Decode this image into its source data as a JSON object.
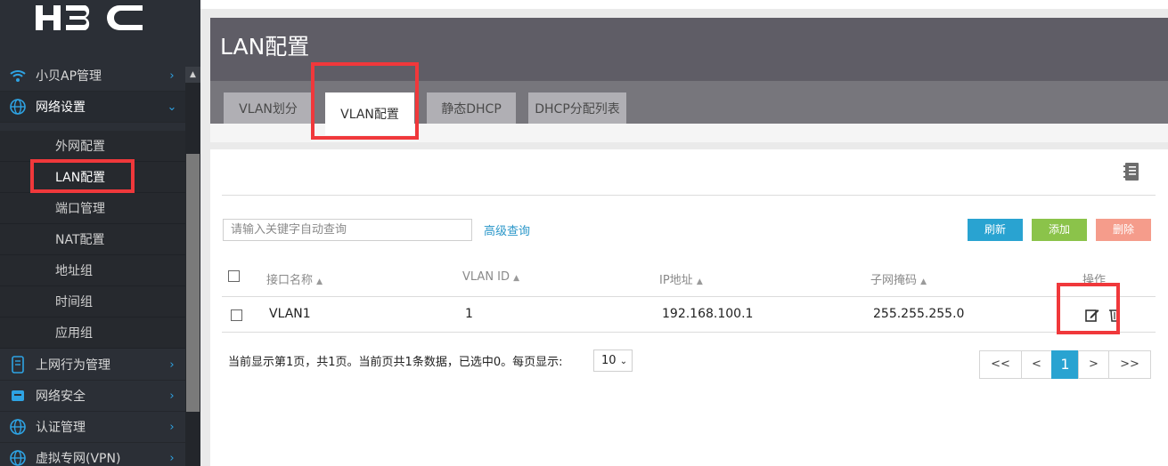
{
  "logo": {
    "text": "H3C"
  },
  "sidebar": {
    "items": [
      {
        "label": "小贝AP管理",
        "icon": "wifi-icon"
      },
      {
        "label": "网络设置",
        "icon": "globe-icon"
      },
      {
        "label": "上网行为管理",
        "icon": "device-icon"
      },
      {
        "label": "网络安全",
        "icon": "shield-icon"
      },
      {
        "label": "认证管理",
        "icon": "globe-icon"
      },
      {
        "label": "虚拟专网(VPN)",
        "icon": "globe-icon"
      }
    ],
    "subitems": [
      "外网配置",
      "LAN配置",
      "端口管理",
      "NAT配置",
      "地址组",
      "时间组",
      "应用组"
    ],
    "selected_subitem": "LAN配置"
  },
  "page": {
    "title": "LAN配置",
    "tabs": [
      "VLAN划分",
      "VLAN配置",
      "静态DHCP",
      "DHCP分配列表"
    ],
    "active_tab": "VLAN配置"
  },
  "toolbar": {
    "search_placeholder": "请输入关键字自动查询",
    "advanced_label": "高级查询",
    "refresh_label": "刷新",
    "add_label": "添加",
    "delete_label": "删除"
  },
  "table": {
    "columns": [
      "接口名称",
      "VLAN ID",
      "IP地址",
      "子网掩码",
      "操作"
    ],
    "rows": [
      {
        "name": "VLAN1",
        "vlan_id": "1",
        "ip": "192.168.100.1",
        "mask": "255.255.255.0"
      }
    ]
  },
  "footer": {
    "summary": "当前显示第1页，共1页。当前页共1条数据，已选中0。每页显示:",
    "page_size": "10",
    "pager": [
      "<<",
      "<",
      "1",
      ">",
      ">>"
    ],
    "current_page": "1"
  },
  "colors": {
    "sidebar_bg": "#2b2f36",
    "accent": "#29a3d1",
    "refresh": "#29a3d1",
    "add": "#8bc34a",
    "delete": "#f59c8b",
    "highlight": "#f0383b"
  }
}
